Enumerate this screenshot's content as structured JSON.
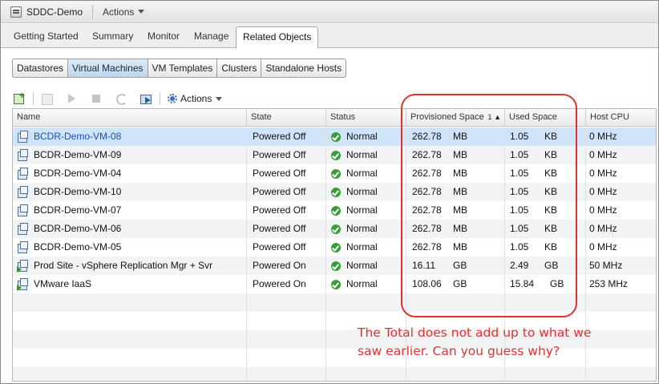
{
  "window": {
    "object_title": "SDDC-Demo",
    "actions_label": "Actions"
  },
  "main_tabs": [
    {
      "label": "Getting Started",
      "active": false
    },
    {
      "label": "Summary",
      "active": false
    },
    {
      "label": "Monitor",
      "active": false
    },
    {
      "label": "Manage",
      "active": false
    },
    {
      "label": "Related Objects",
      "active": true
    }
  ],
  "sub_tabs": [
    {
      "label": "Datastores",
      "active": false
    },
    {
      "label": "Virtual Machines",
      "active": true
    },
    {
      "label": "VM Templates",
      "active": false
    },
    {
      "label": "Clusters",
      "active": false
    },
    {
      "label": "Standalone Hosts",
      "active": false
    }
  ],
  "toolbar": {
    "actions_label": "Actions",
    "icons": [
      "new-vm-icon",
      "clone-icon",
      "power-on-icon",
      "power-off-icon",
      "refresh-icon",
      "migrate-icon",
      "gear-icon"
    ]
  },
  "grid": {
    "columns": [
      "Name",
      "State",
      "Status",
      "Provisioned Space",
      "Used Space",
      "Host CPU"
    ],
    "sort": {
      "column": "Provisioned Space",
      "order": "1",
      "direction": "▲"
    },
    "rows": [
      {
        "name": "BCDR-Demo-VM-08",
        "state": "Powered Off",
        "status": "Normal",
        "prov_val": "262.78",
        "prov_unit": "MB",
        "used_val": "1.05",
        "used_unit": "KB",
        "cpu": "0 MHz",
        "selected": true,
        "powered_on": false
      },
      {
        "name": "BCDR-Demo-VM-09",
        "state": "Powered Off",
        "status": "Normal",
        "prov_val": "262.78",
        "prov_unit": "MB",
        "used_val": "1.05",
        "used_unit": "KB",
        "cpu": "0 MHz",
        "selected": false,
        "powered_on": false
      },
      {
        "name": "BCDR-Demo-VM-04",
        "state": "Powered Off",
        "status": "Normal",
        "prov_val": "262.78",
        "prov_unit": "MB",
        "used_val": "1.05",
        "used_unit": "KB",
        "cpu": "0 MHz",
        "selected": false,
        "powered_on": false
      },
      {
        "name": "BCDR-Demo-VM-10",
        "state": "Powered Off",
        "status": "Normal",
        "prov_val": "262.78",
        "prov_unit": "MB",
        "used_val": "1.05",
        "used_unit": "KB",
        "cpu": "0 MHz",
        "selected": false,
        "powered_on": false
      },
      {
        "name": "BCDR-Demo-VM-07",
        "state": "Powered Off",
        "status": "Normal",
        "prov_val": "262.78",
        "prov_unit": "MB",
        "used_val": "1.05",
        "used_unit": "KB",
        "cpu": "0 MHz",
        "selected": false,
        "powered_on": false
      },
      {
        "name": "BCDR-Demo-VM-06",
        "state": "Powered Off",
        "status": "Normal",
        "prov_val": "262.78",
        "prov_unit": "MB",
        "used_val": "1.05",
        "used_unit": "KB",
        "cpu": "0 MHz",
        "selected": false,
        "powered_on": false
      },
      {
        "name": "BCDR-Demo-VM-05",
        "state": "Powered Off",
        "status": "Normal",
        "prov_val": "262.78",
        "prov_unit": "MB",
        "used_val": "1.05",
        "used_unit": "KB",
        "cpu": "0 MHz",
        "selected": false,
        "powered_on": false
      },
      {
        "name": "Prod Site - vSphere Replication Mgr + Svr",
        "state": "Powered On",
        "status": "Normal",
        "prov_val": "16.11",
        "prov_unit": "GB",
        "used_val": "2.49",
        "used_unit": "GB",
        "cpu": "50 MHz",
        "selected": false,
        "powered_on": true
      },
      {
        "name": "VMware IaaS",
        "state": "Powered On",
        "status": "Normal",
        "prov_val": "108.06",
        "prov_unit": "GB",
        "used_val": "15.84",
        "used_unit": "GB",
        "cpu": "253 MHz",
        "selected": false,
        "powered_on": true
      }
    ]
  },
  "annotation": {
    "color": "#e03131",
    "line1": "The Total does not add up to what we",
    "line2": "saw earlier. Can you guess why?"
  },
  "colors": {
    "selected_row": "#cfe4f8",
    "link": "#1b4fb5",
    "status_ok": "#3a9d3a"
  }
}
